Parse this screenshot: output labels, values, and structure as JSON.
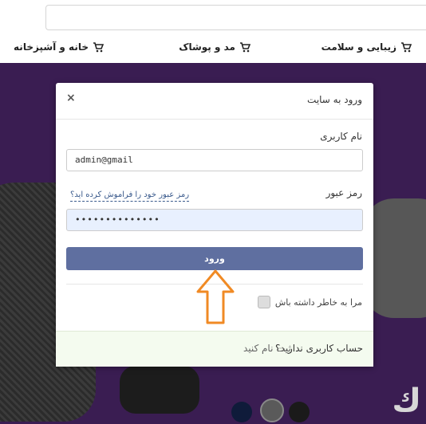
{
  "categories": [
    {
      "label": "زیبایی و سلامت",
      "icon": "cart-icon"
    },
    {
      "label": "مد و پوشاک",
      "icon": "cart-icon"
    },
    {
      "label": "خانه و آشپزخانه",
      "icon": "cart-icon"
    }
  ],
  "modal": {
    "title": "ورود به سایت",
    "close": "×",
    "username_label": "نام کاربری",
    "username_value": "admin@gmail",
    "password_label": "رمز عبور",
    "forgot_link": "رمز عبور خود را فراموش کرده اید؟",
    "password_value": "••••••••••••••",
    "login_button": "ورود",
    "remember_label": "مرا به خاطر داشته باش",
    "no_account": "حساب کاربری ندارید؟",
    "register_link": "ثبت نام کنید"
  },
  "hero": {
    "brand_mark": "ك"
  },
  "colors": {
    "hero_bg": "#3a1d52",
    "button": "#5f6fa0",
    "annotation_arrow": "#f08a24"
  }
}
